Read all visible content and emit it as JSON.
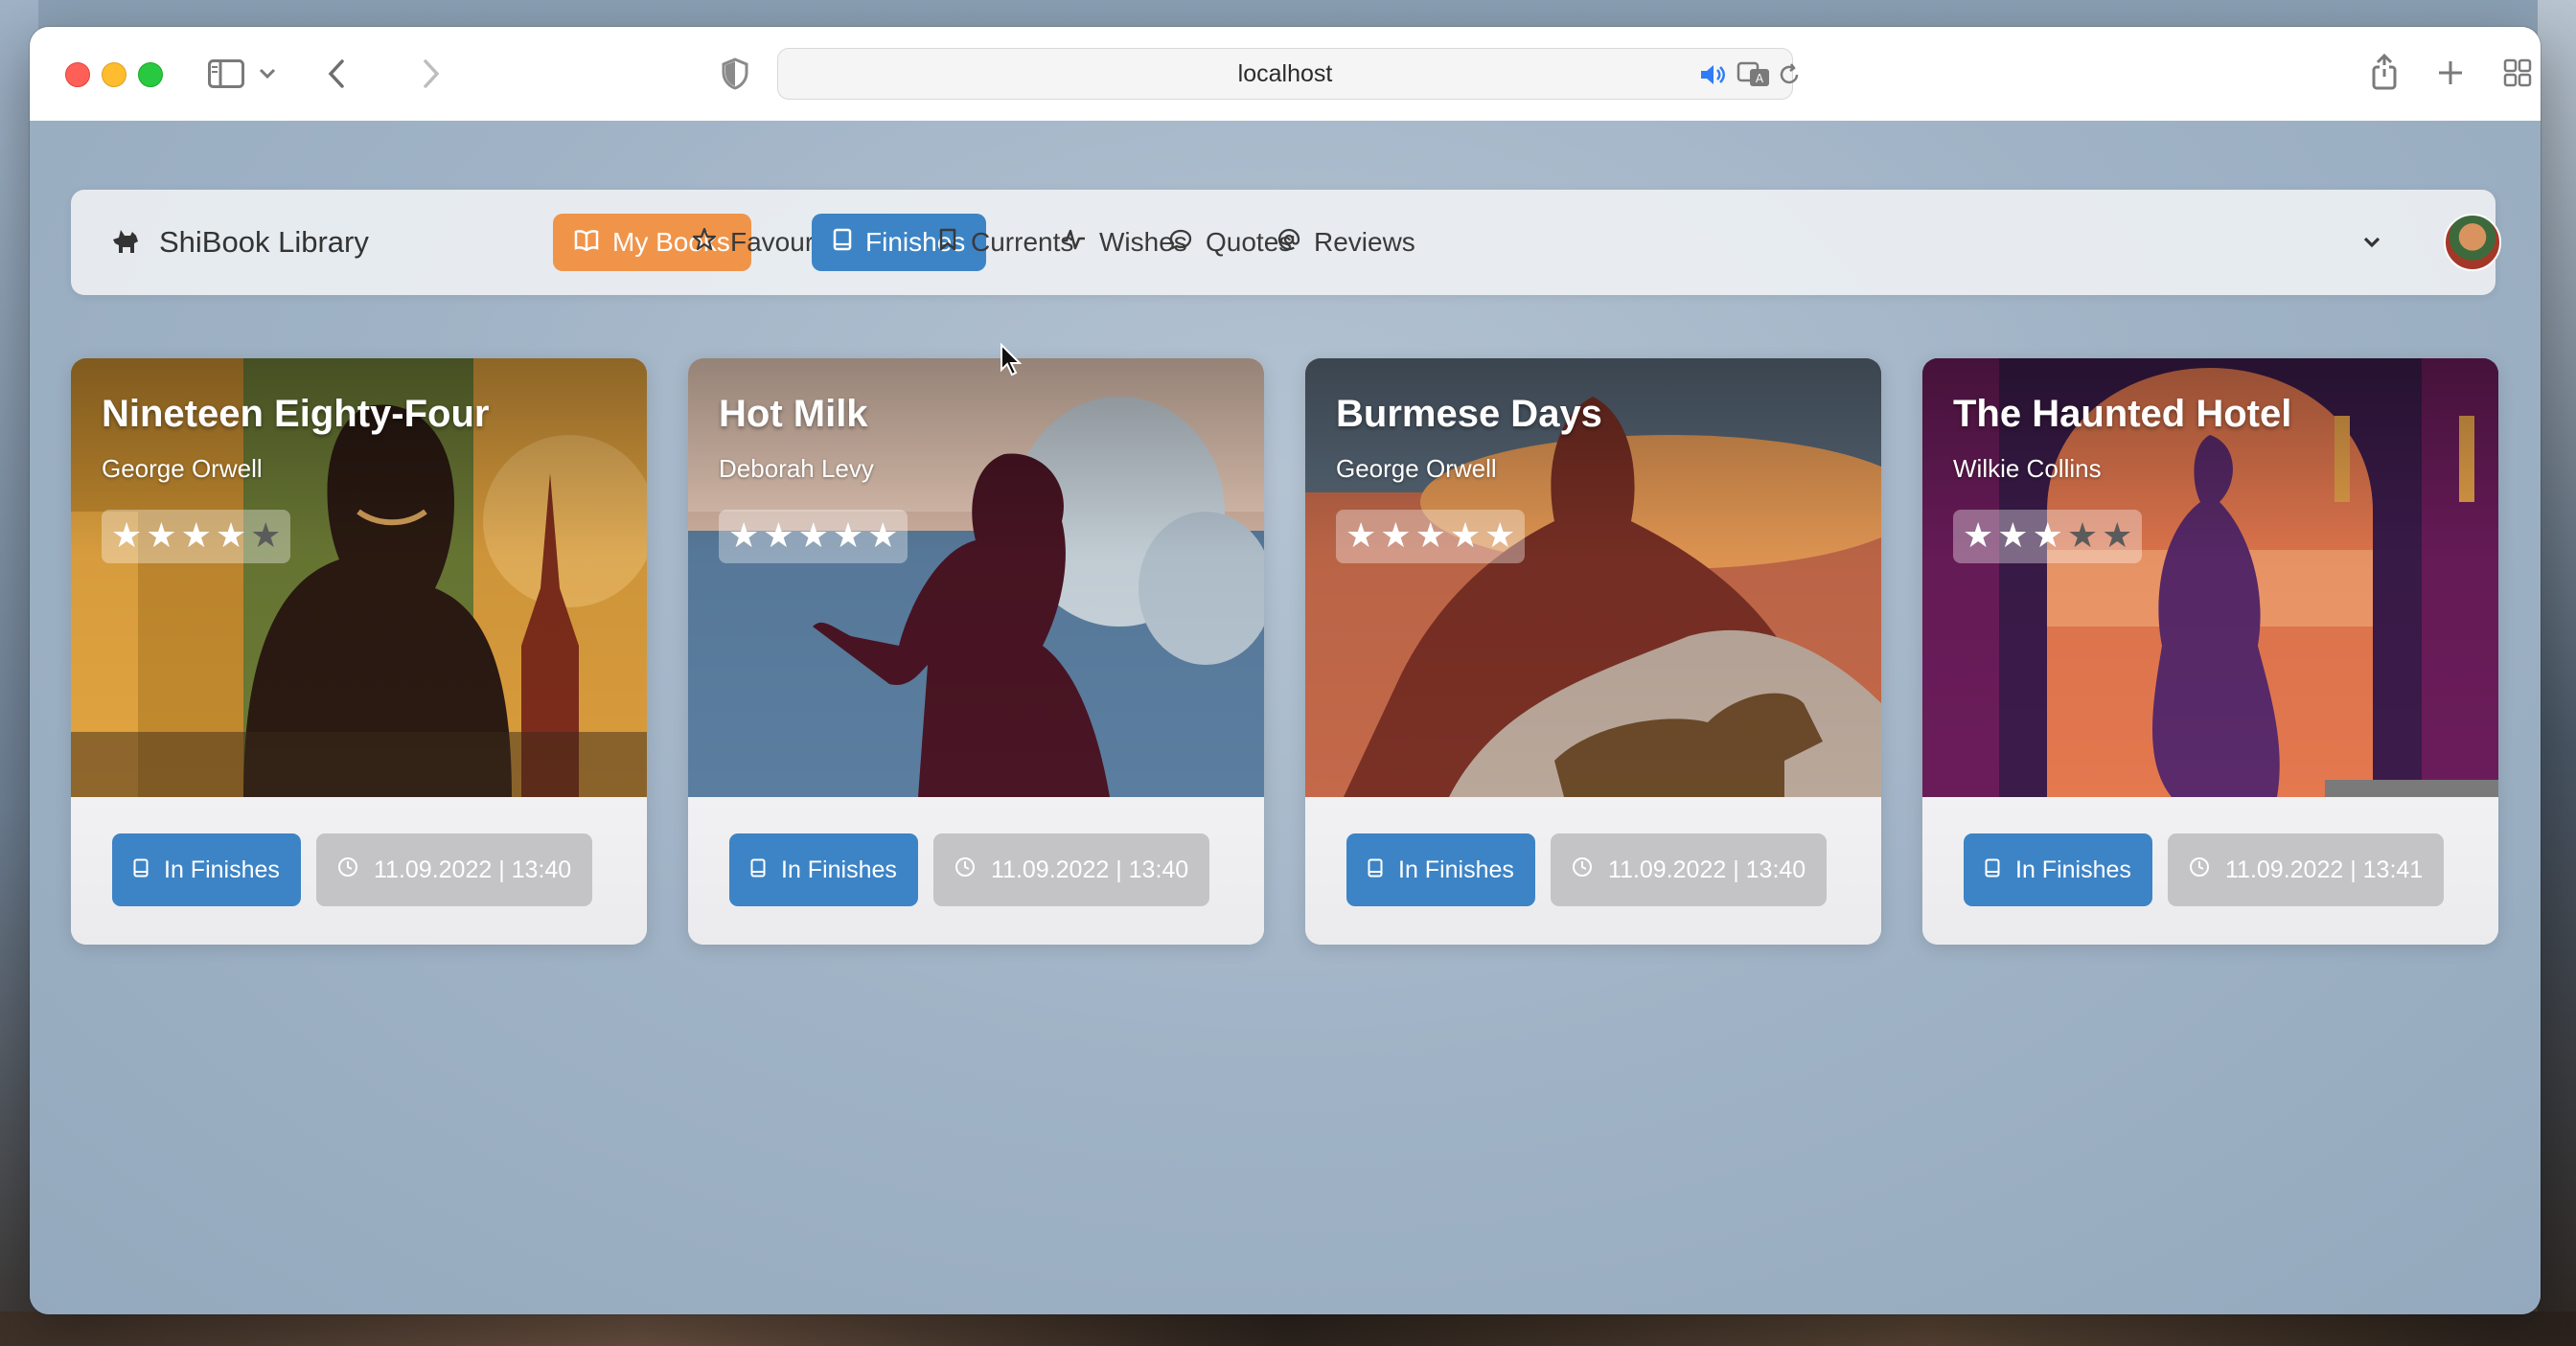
{
  "browser": {
    "url": "localhost"
  },
  "navbar": {
    "brand": "ShiBook Library",
    "items": [
      {
        "label": "My Books",
        "icon": "open-book-icon"
      },
      {
        "label": "Favourites",
        "icon": "star-icon"
      },
      {
        "label": "Finishes",
        "icon": "book-icon"
      },
      {
        "label": "Currents",
        "icon": "bookmark-icon"
      },
      {
        "label": "Wishes",
        "icon": "activity-icon"
      },
      {
        "label": "Quotes",
        "icon": "speech-bubble-icon"
      },
      {
        "label": "Reviews",
        "icon": "at-icon"
      }
    ],
    "active_item": "Finishes",
    "highlighted_item": "My Books"
  },
  "colors": {
    "orange_accent": "#f0944a",
    "blue_accent": "#3d84c6",
    "date_button": "#c4c4c6"
  },
  "books": [
    {
      "title": "Nineteen Eighty-Four",
      "author": "George Orwell",
      "rating": 4,
      "status": "In Finishes",
      "date": "11.09.2022 | 13:40"
    },
    {
      "title": "Hot Milk",
      "author": "Deborah Levy",
      "rating": 5,
      "status": "In Finishes",
      "date": "11.09.2022 | 13:40"
    },
    {
      "title": "Burmese Days",
      "author": "George Orwell",
      "rating": 5,
      "status": "In Finishes",
      "date": "11.09.2022 | 13:40"
    },
    {
      "title": "The Haunted Hotel",
      "author": "Wilkie Collins",
      "rating": 3,
      "status": "In Finishes",
      "date": "11.09.2022 | 13:41"
    }
  ]
}
